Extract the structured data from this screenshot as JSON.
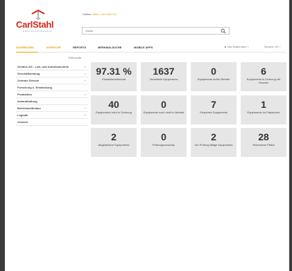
{
  "brand": {
    "name": "CarlStahl",
    "tagline": "UMSCHLAGTECHNIK",
    "accent": "#d3271e",
    "highlight": "#e8a200"
  },
  "header": {
    "hotline_label": "Hotline:",
    "hotline_number": "0800 / 184 5447-01",
    "search_placeholder": "Suche"
  },
  "nav": {
    "tabs": [
      {
        "label": "DASHBOARD",
        "active": true
      },
      {
        "label": "INVENTUR",
        "active": false
      },
      {
        "label": "REPORTS",
        "active": false
      },
      {
        "label": "MERKMALSUCHE",
        "active": false
      },
      {
        "label": "MOBILE APPS",
        "active": false
      }
    ],
    "user": "Max Mustermann",
    "language": "Sprache: DE"
  },
  "edit_mode_label": "Edit mode",
  "sidebar": {
    "items": [
      {
        "label": "Gerätes AG - Luft- und Antriebstechnik",
        "chevron": true
      },
      {
        "label": "Geschäftsleitung",
        "chevron": true
      },
      {
        "label": "Zentrale Dienste",
        "chevron": true
      },
      {
        "label": "Forschung u. Entwicklung",
        "chevron": false
      },
      {
        "label": "Produktion",
        "chevron": true
      },
      {
        "label": "Instandhaltung",
        "chevron": false
      },
      {
        "label": "Betriebsmittelbau",
        "chevron": true
      },
      {
        "label": "Logistik",
        "chevron": true
      },
      {
        "label": "Vertrieb",
        "chevron": false
      }
    ]
  },
  "tiles": [
    {
      "value": "97.31 %",
      "label": "Einsatzbereitschaft"
    },
    {
      "value": "1637",
      "label": "Verwaltete Equipments"
    },
    {
      "value": "0",
      "label": "Equipments außer Betrieb"
    },
    {
      "value": "6",
      "label": "Equipments in Ordnung mit Hinweis"
    },
    {
      "value": "40",
      "label": "Equipments nicht in Ordnung"
    },
    {
      "value": "0",
      "label": "Equipments noch nicht in Betrieb"
    },
    {
      "value": "7",
      "label": "Gesperrte Equipments"
    },
    {
      "value": "1",
      "label": "Equipments im Papierkorb"
    },
    {
      "value": "2",
      "label": "Abgelaufene Equipments"
    },
    {
      "value": "0",
      "label": "Prüfungsvorschau"
    },
    {
      "value": "2",
      "label": "Zur Prüfung fällige Equipments"
    },
    {
      "value": "28",
      "label": "Technische Plätze"
    }
  ]
}
